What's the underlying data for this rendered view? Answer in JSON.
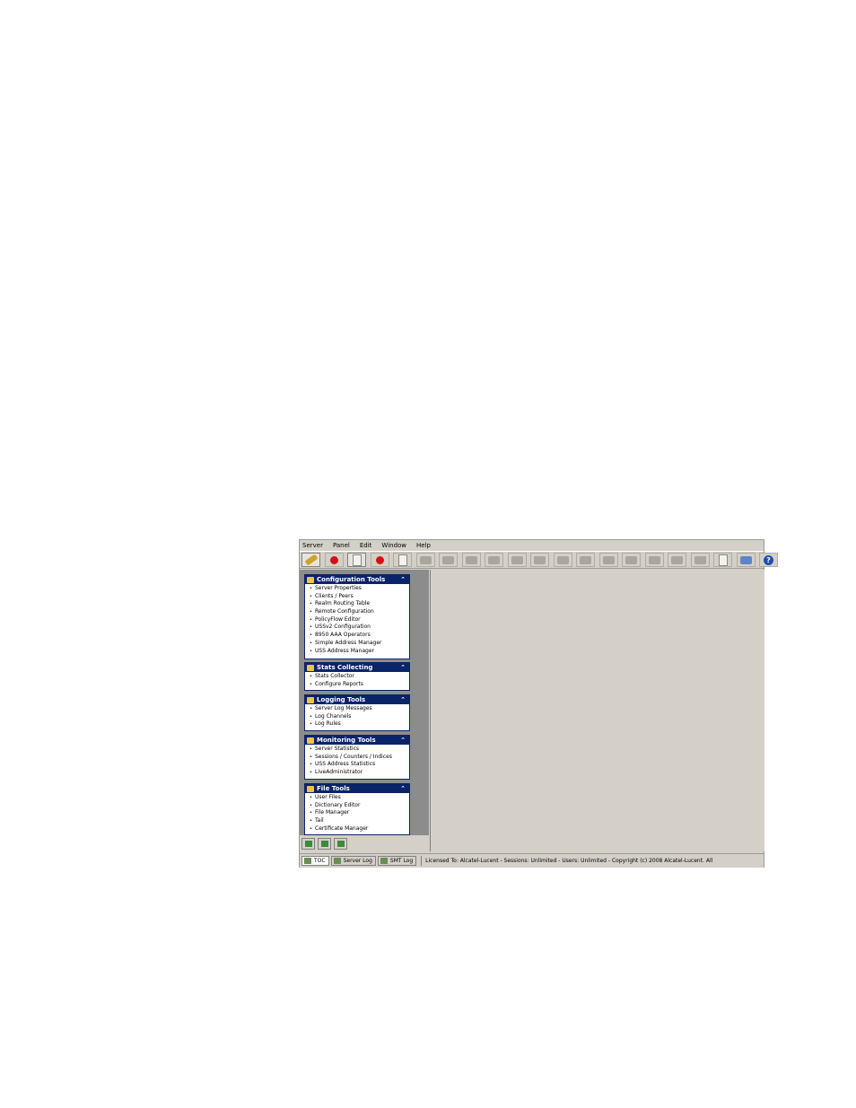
{
  "menu": [
    "Server",
    "Panel",
    "Edit",
    "Window",
    "Help"
  ],
  "toolbar_icons": [
    "key-icon",
    "red-circle-icon",
    "document-icon",
    "red-circle-icon",
    "document-icon",
    "disabled-icon",
    "disabled-icon",
    "refresh-icon",
    "disabled-icon",
    "disabled-icon",
    "print-icon",
    "swap-icon",
    "cut-icon",
    "copy-icon",
    "paste-icon",
    "find-icon",
    "find-next-icon",
    "link-icon",
    "doc-arrow-icon",
    "monitor-icon",
    "help-icon"
  ],
  "sections": [
    {
      "title": "Configuration Tools",
      "items": [
        "Server Properties",
        "Clients / Peers",
        "Realm Routing Table",
        "Remote Configuration",
        "PolicyFlow Editor",
        "USSv2 Configuration",
        "8950 AAA Operators",
        "Simple Address Manager",
        "USS Address Manager"
      ]
    },
    {
      "title": "Stats Collecting",
      "items": [
        "Stats Collector",
        "Configure Reports"
      ]
    },
    {
      "title": "Logging Tools",
      "items": [
        "Server Log Messages",
        "Log Channels",
        "Log Rules"
      ]
    },
    {
      "title": "Monitoring Tools",
      "items": [
        "Server Statistics",
        "Sessions / Counters / Indices",
        "USS Address Statistics",
        "LiveAdministrator"
      ]
    },
    {
      "title": "File Tools",
      "items": [
        "User Files",
        "Dictionary Editor",
        "File Manager",
        "Tail",
        "Certificate Manager"
      ]
    }
  ],
  "status": {
    "tabs": [
      "TOC",
      "Server Log",
      "SMT Log"
    ],
    "license": "Licensed To: Alcatel-Lucent - Sessions: Unlimited - Users: Unlimited - Copyright (c) 2008 Alcatel-Lucent. All"
  }
}
